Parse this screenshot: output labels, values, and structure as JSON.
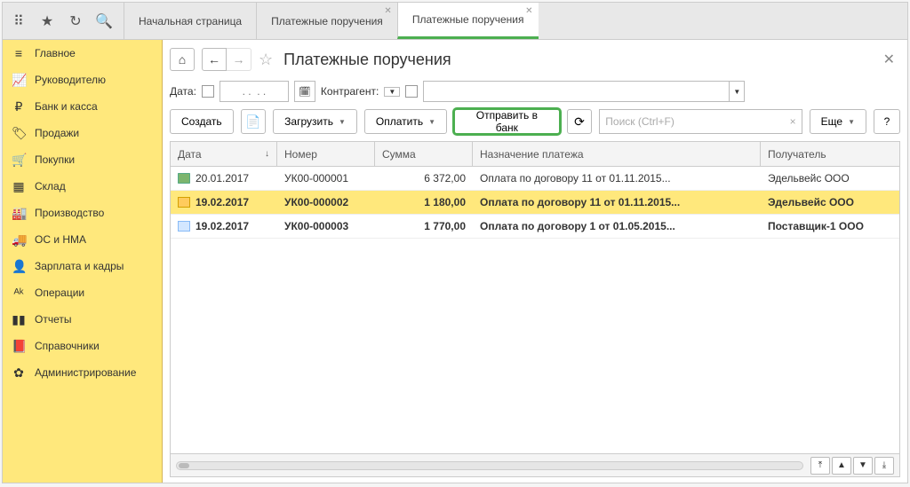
{
  "topbar": {
    "tabs": [
      {
        "label": "Начальная страница",
        "closable": false
      },
      {
        "label": "Платежные поручения",
        "closable": true
      },
      {
        "label": "Платежные поручения",
        "closable": true,
        "active": true
      }
    ]
  },
  "sidebar": {
    "items": [
      {
        "icon": "≡",
        "label": "Главное"
      },
      {
        "icon": "📈",
        "label": "Руководителю"
      },
      {
        "icon": "₽",
        "label": "Банк и касса"
      },
      {
        "icon": "🏷",
        "label": "Продажи"
      },
      {
        "icon": "🛒",
        "label": "Покупки"
      },
      {
        "icon": "▦",
        "label": "Склад"
      },
      {
        "icon": "🏭",
        "label": "Производство"
      },
      {
        "icon": "🚚",
        "label": "ОС и НМА"
      },
      {
        "icon": "👤",
        "label": "Зарплата и кадры"
      },
      {
        "icon": "ᴬᵏ",
        "label": "Операции"
      },
      {
        "icon": "▮▮",
        "label": "Отчеты"
      },
      {
        "icon": "📕",
        "label": "Справочники"
      },
      {
        "icon": "✿",
        "label": "Администрирование"
      }
    ]
  },
  "header": {
    "title": "Платежные поручения"
  },
  "filters": {
    "date_label": "Дата:",
    "date_placeholder": ". .  . .",
    "contractor_label": "Контрагент:"
  },
  "toolbar": {
    "create": "Создать",
    "load": "Загрузить",
    "pay": "Оплатить",
    "send_bank": "Отправить в банк",
    "search_placeholder": "Поиск (Ctrl+F)",
    "more": "Еще",
    "help": "?"
  },
  "table": {
    "headers": {
      "date": "Дата",
      "number": "Номер",
      "sum": "Сумма",
      "purpose": "Назначение платежа",
      "payee": "Получатель"
    },
    "rows": [
      {
        "icon": "ic1",
        "date": "20.01.2017",
        "number": "УК00-000001",
        "sum": "6 372,00",
        "purpose": "Оплата по договору 11 от 01.11.2015...",
        "payee": "Эдельвейс ООО",
        "bold": false,
        "selected": false
      },
      {
        "icon": "ic2",
        "date": "19.02.2017",
        "number": "УК00-000002",
        "sum": "1 180,00",
        "purpose": "Оплата по договору 11 от 01.11.2015...",
        "payee": "Эдельвейс ООО",
        "bold": true,
        "selected": true
      },
      {
        "icon": "ic3",
        "date": "19.02.2017",
        "number": "УК00-000003",
        "sum": "1 770,00",
        "purpose": "Оплата по договору 1 от 01.05.2015...",
        "payee": "Поставщик-1 ООО",
        "bold": true,
        "selected": false
      }
    ]
  }
}
